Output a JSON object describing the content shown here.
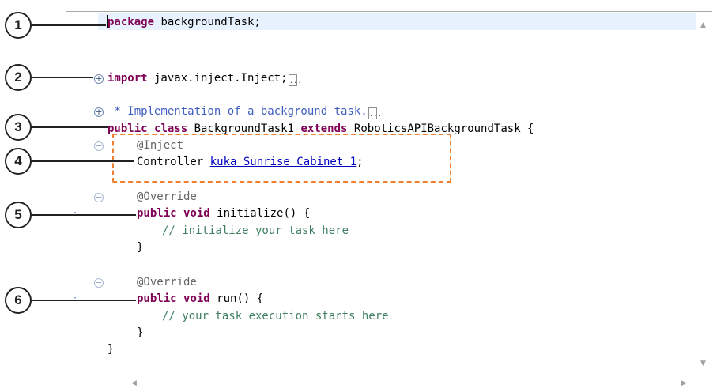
{
  "code": {
    "l1_kw": "package",
    "l1_rest": " backgroundTask;",
    "l2_kw": "import",
    "l2_rest": " javax.inject.Inject;",
    "l3_javadoc": " * Implementation of a background task.",
    "l4_kw1": "public",
    "l4_kw2": "class",
    "l4_name": " BackgroundTask1 ",
    "l4_kw3": "extends",
    "l4_rest": " RoboticsAPIBackgroundTask {",
    "l5_ann": "@Inject",
    "l6_type": "Controller ",
    "l6_field": "kuka_Sunrise_Cabinet_1",
    "l6_end": ";",
    "l7_ann": "@Override",
    "l8_kw1": "public",
    "l8_kw2": "void",
    "l8_rest": " initialize() {",
    "l9_comment": "// initialize your task here",
    "l10_brace": "}",
    "l11_ann": "@Override",
    "l12_kw1": "public",
    "l12_kw2": "void",
    "l12_rest": " run() {",
    "l13_comment": "// your task execution starts here",
    "l14_brace": "}",
    "l15_brace": "}",
    "ellipsis": "..."
  },
  "callouts": [
    "1",
    "2",
    "3",
    "4",
    "5",
    "6"
  ],
  "colors": {
    "keyword": "#7f0055",
    "comment": "#3f7f5f",
    "javadoc": "#3f5fbf",
    "annotation": "#646464",
    "field": "#0000c0",
    "highlight_box": "#f08030",
    "current_line": "#e8f2fe"
  },
  "icons": [
    "fold-expand-icon",
    "fold-collapse-icon",
    "scroll-up-icon",
    "scroll-down-icon",
    "scroll-left-icon",
    "scroll-right-icon"
  ]
}
